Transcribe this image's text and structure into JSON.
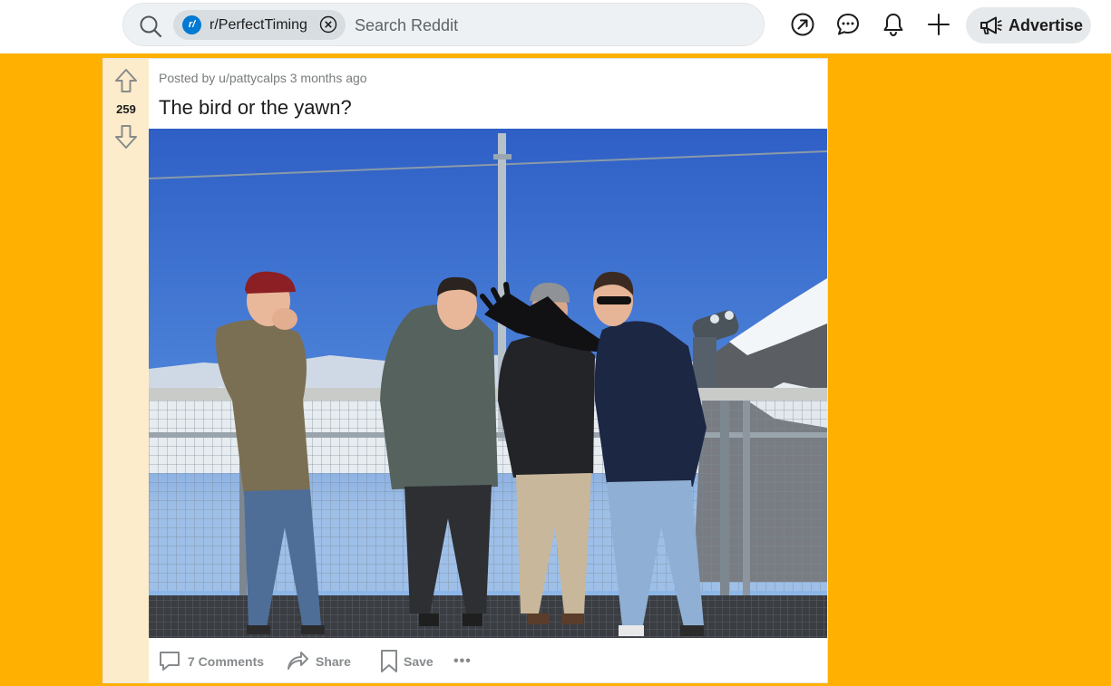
{
  "header": {
    "search_chip_label": "r/PerfectTiming",
    "search_chip_avatar": "r/",
    "search_placeholder": "Search Reddit",
    "icons": [
      "search-icon",
      "close-circle-icon",
      "popular-arrow-icon",
      "chat-bubble-icon",
      "bell-icon",
      "plus-icon",
      "megaphone-icon"
    ],
    "advertise_label": "Advertise"
  },
  "post": {
    "vote_count": "259",
    "meta": "Posted by u/pattycalps 3 months ago",
    "title": "The bird or the yawn?",
    "actions": {
      "comments_label": "7 Comments",
      "share_label": "Share",
      "save_label": "Save",
      "more_label": "•••"
    }
  },
  "colors": {
    "page_background": "#FFB000",
    "vote_rail": "#FDECCB",
    "subreddit_blue": "#0079D3",
    "muted_text": "#787C7E"
  }
}
